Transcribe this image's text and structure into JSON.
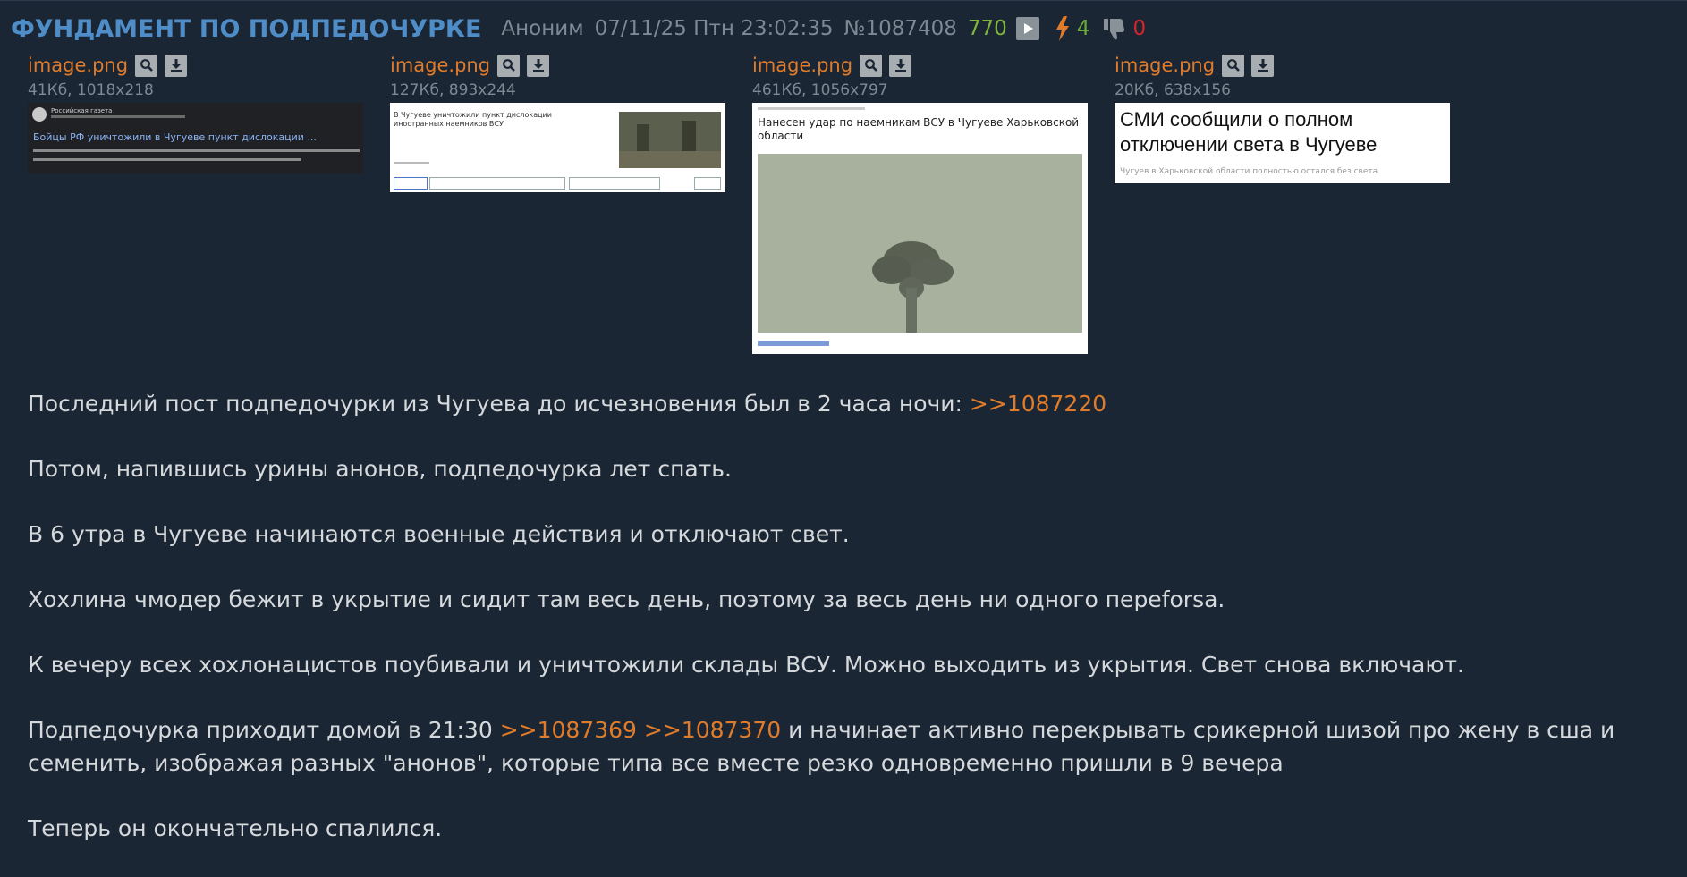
{
  "post": {
    "subject": "ФУНДАМЕНТ ПО ПОДПЕДОЧУРКЕ",
    "author": "Аноним",
    "datetime": "07/11/25 Птн 23:02:35",
    "number": "№1087408",
    "views": "770",
    "likes": "4",
    "dislikes": "0"
  },
  "files": [
    {
      "name": "image.png",
      "info": "41Кб, 1018x218",
      "thumb": {
        "source": "Российская газета",
        "headline": "Бойцы РФ уничтожили в Чугуеве пункт дислокации ..."
      }
    },
    {
      "name": "image.png",
      "info": "127Кб, 893x244",
      "thumb": {
        "headline": "В Чугуеве уничтожили пункт дислокации иностранных наемников ВСУ"
      }
    },
    {
      "name": "image.png",
      "info": "461Кб, 1056x797",
      "thumb": {
        "headline": "Нанесен удар по наемникам ВСУ в Чугуеве Харьковской области"
      }
    },
    {
      "name": "image.png",
      "info": "20Кб, 638x156",
      "thumb": {
        "headline": "СМИ сообщили о полном отключении света в Чугуеве",
        "sub": "Чугуев в Харьковской области полностью остался без света"
      }
    }
  ],
  "body": {
    "p1_text": "Последний пост подпедочурки из Чугуева до исчезновения был в 2 часа ночи: ",
    "p1_link": ">>1087220",
    "p2": "Потом, напившись урины анонов, подпедочурка лет спать.",
    "p3": "В 6 утра в Чугуеве начинаются военные действия и отключают свет.",
    "p4": "Хохлина чмодер бежит в укрытие и сидит там весь день, поэтому за весь день ни одного переforsa.",
    "p5": "К вечеру всех хохлонацистов поубивали и уничтожили склады ВСУ. Можно выходить из укрытия. Свет снова включают.",
    "p6_text_a": "Подпедочурка приходит домой в 21:30 ",
    "p6_link_a": ">>1087369",
    "p6_link_b": ">>1087370",
    "p6_text_b": " и начинает активно перекрывать срикерной шизой про жену в сша и семенить, изображая разных \"анонов\", которые типа все вместе резко одновременно пришли в 9 вечера",
    "p7": "Теперь он окончательно спалился."
  }
}
